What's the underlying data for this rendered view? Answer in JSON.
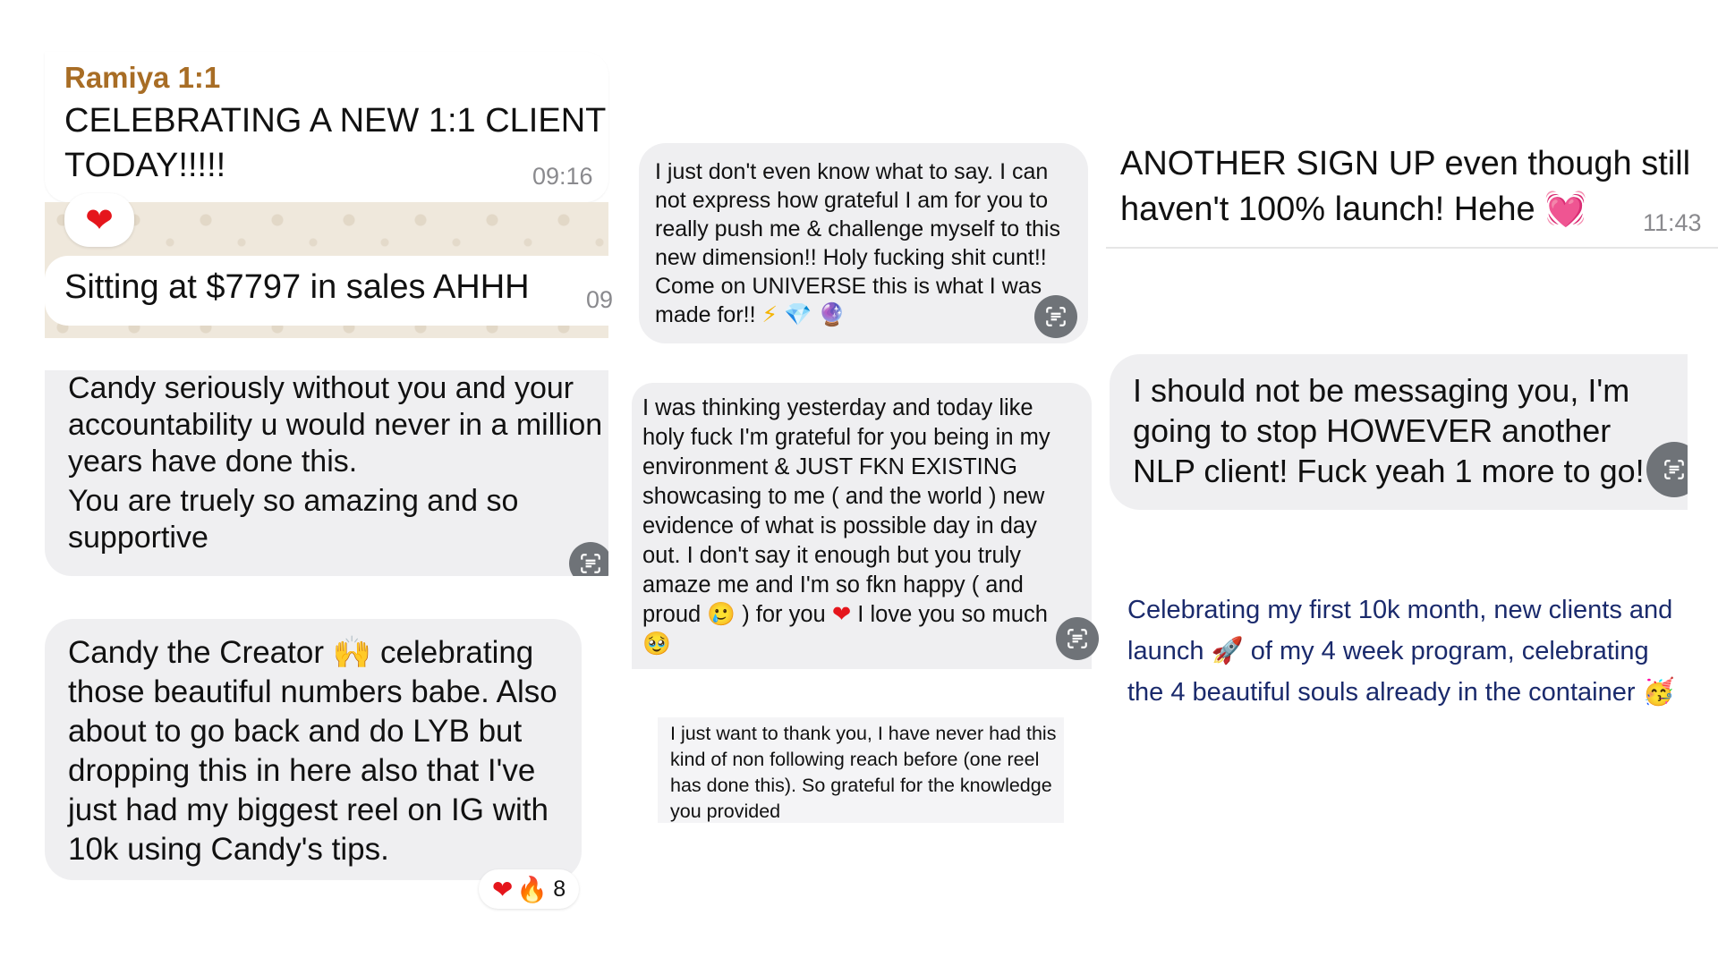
{
  "col1": {
    "msg1": {
      "sender": "Ramiya 1:1",
      "text_line1": "CELEBRATING A NEW 1:1 CLIENT",
      "text_line2": "TODAY!!!!!",
      "time": "09:16",
      "reaction": "❤"
    },
    "msg2": {
      "text": "Sitting at $7797 in sales AHHH",
      "time_partial": "09"
    },
    "msg3": {
      "para1": "Candy seriously without you and your accountability u would never in a million years have done this.",
      "para2": "You are truely so amazing and so supportive"
    },
    "msg4": {
      "text_part1": "Candy the Creator",
      "emoji": "🙌",
      "text_part2": "celebrating those beautiful numbers babe. Also about to go back and do LYB but dropping this in here also that I've just had my biggest reel on IG with 10k using Candy's tips.",
      "reactions": [
        "❤",
        "🔥"
      ],
      "reaction_count": "8"
    }
  },
  "col2": {
    "msg1": {
      "text": "I just don't even know what to say. I can not express how grateful I am for you to really push me & challenge myself to this new dimension!! Holy fucking shit cunt!! Come on UNIVERSE this is what I was made for!!",
      "emojis": [
        "⚡",
        "💎",
        "🔮"
      ]
    },
    "msg2": {
      "text_part1": "I was thinking yesterday and today like holy fuck I'm grateful for you being in my environment & JUST FKN EXISTING showcasing to me ( and the world ) new evidence of what is possible day in day out. I don't say it enough but you truly amaze me and I'm so fkn happy ( and proud",
      "emoji1": "🥲",
      "text_part2": ") for you",
      "emoji2": "❤",
      "text_part3": "I love you so much",
      "emoji3": "🥹"
    },
    "msg3": {
      "text": "I just want to thank you, I have never had this kind of non following reach before (one reel has done this). So grateful for the knowledge you provided"
    }
  },
  "col3": {
    "msg1": {
      "text": "ANOTHER SIGN UP even though still haven't 100% launch! Hehe",
      "emoji": "💓",
      "time": "11:43"
    },
    "msg2": {
      "text": "I should not be messaging you, I'm going to stop HOWEVER another NLP client! Fuck yeah 1 more to go!"
    },
    "msg3": {
      "text_part1": "Celebrating my first 10k month, new clients and launch",
      "emoji1": "🚀",
      "text_part2": "of my 4 week program, celebrating the 4 beautiful souls already in the container",
      "emoji2": "🥳"
    }
  },
  "colors": {
    "sender_name": "#a86d25",
    "bubble_gray": "#efeff1",
    "navy_text": "#1a2a6c",
    "heart": "#e5161c"
  }
}
